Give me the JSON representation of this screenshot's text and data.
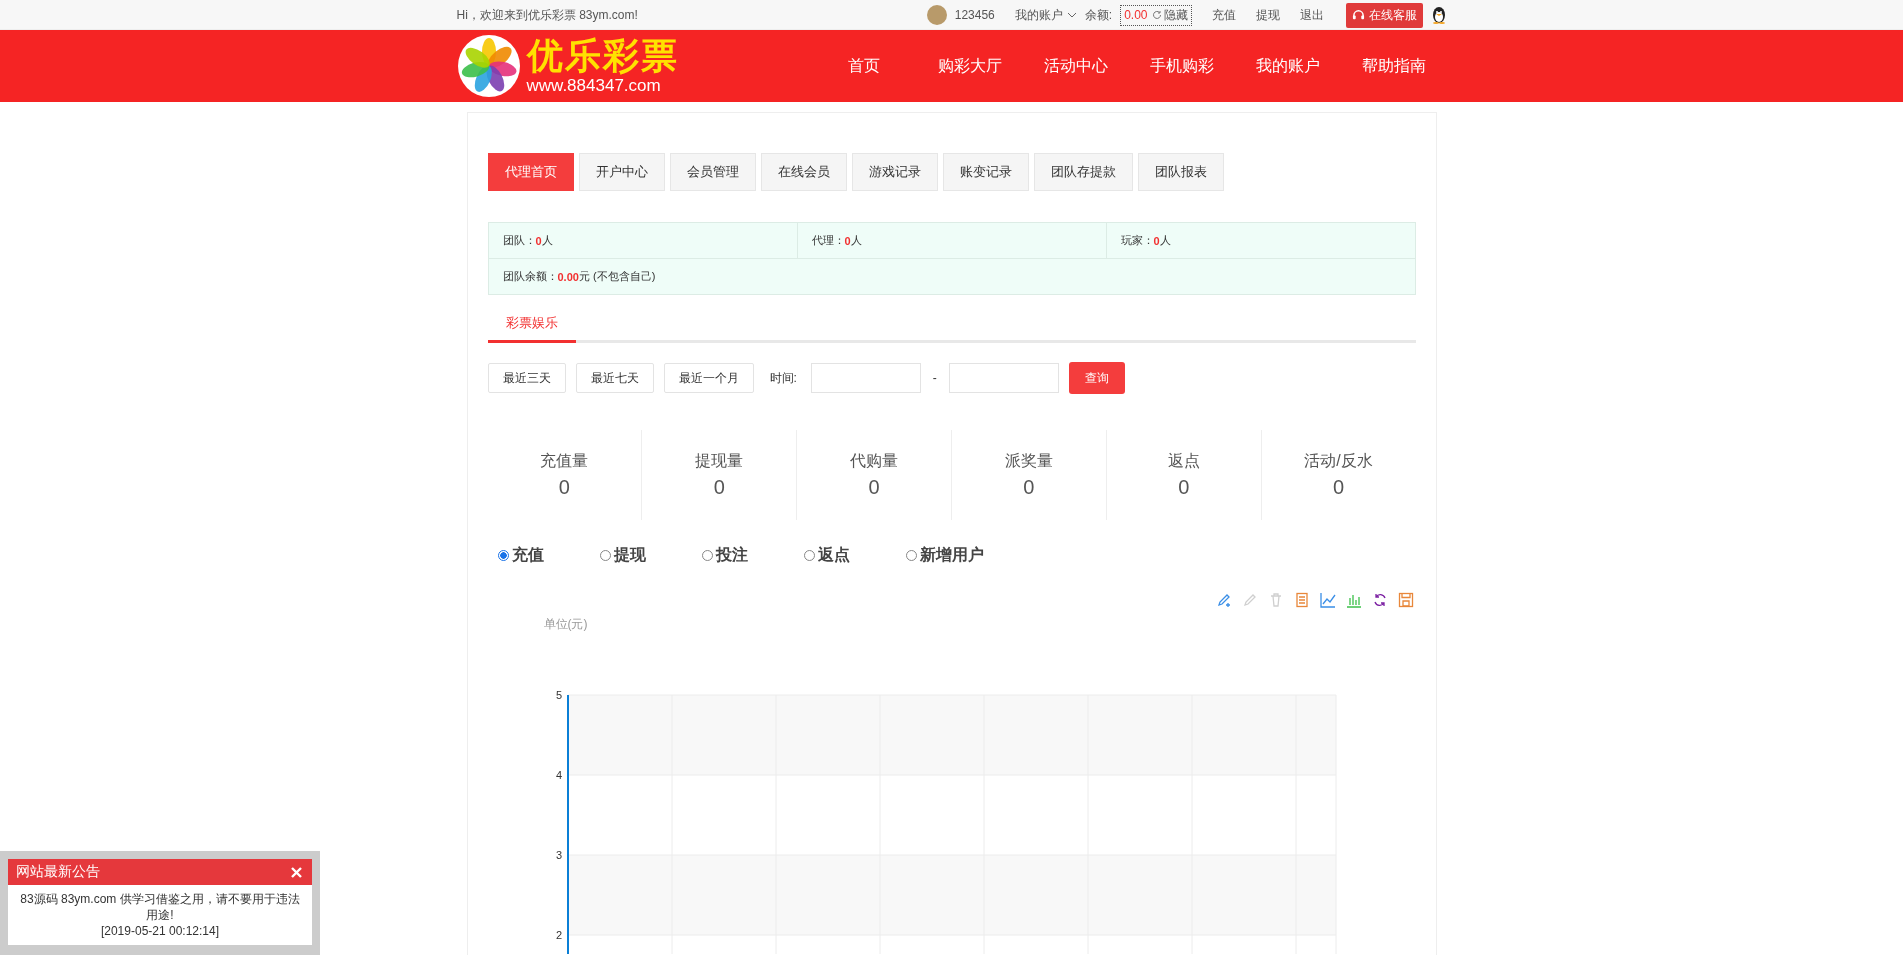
{
  "top_bar": {
    "greeting": "Hi，欢迎来到优乐彩票 83ym.com!",
    "username": "123456",
    "account_menu": "我的账户",
    "balance_label": "余额:",
    "balance": "0.00",
    "hide_toggle": "隐藏",
    "links": [
      "充值",
      "提现",
      "退出"
    ],
    "support_button": "在线客服"
  },
  "header": {
    "logo_title": "优乐彩票",
    "logo_url": "www.884347.com",
    "nav": [
      "首页",
      "购彩大厅",
      "活动中心",
      "手机购彩",
      "我的账户",
      "帮助指南"
    ]
  },
  "agent_tabs": [
    {
      "label": "代理首页",
      "selected": true
    },
    {
      "label": "开户中心",
      "selected": false
    },
    {
      "label": "会员管理",
      "selected": false
    },
    {
      "label": "在线会员",
      "selected": false
    },
    {
      "label": "游戏记录",
      "selected": false
    },
    {
      "label": "账变记录",
      "selected": false
    },
    {
      "label": "团队存提款",
      "selected": false
    },
    {
      "label": "团队报表",
      "selected": false
    }
  ],
  "summary": {
    "cells": [
      {
        "label": "团队：",
        "value": "0",
        "unit": "人"
      },
      {
        "label": "代理：",
        "value": "0",
        "unit": "人"
      },
      {
        "label": "玩家：",
        "value": "0",
        "unit": "人"
      }
    ],
    "balance": {
      "label": "团队余额：",
      "value": "0.00",
      "unit": "元",
      "note": "(不包含自己)"
    }
  },
  "sub_tabs": [
    {
      "label": "彩票娱乐",
      "selected": true
    }
  ],
  "filter": {
    "quick_ranges": [
      "最近三天",
      "最近七天",
      "最近一个月"
    ],
    "time_label": "时间:",
    "separator": "-",
    "query_button": "查询"
  },
  "stats": [
    {
      "label": "充值量",
      "value": "0"
    },
    {
      "label": "提现量",
      "value": "0"
    },
    {
      "label": "代购量",
      "value": "0"
    },
    {
      "label": "派奖量",
      "value": "0"
    },
    {
      "label": "返点",
      "value": "0"
    },
    {
      "label": "活动/反水",
      "value": "0"
    }
  ],
  "chart_options": [
    {
      "label": "充值",
      "selected": true
    },
    {
      "label": "提现",
      "selected": false
    },
    {
      "label": "投注",
      "selected": false
    },
    {
      "label": "返点",
      "selected": false
    },
    {
      "label": "新增用户",
      "selected": false
    }
  ],
  "chart": {
    "unit": "单位(元)",
    "y_axis_labels": [
      "5",
      "4",
      "3",
      "2"
    ]
  },
  "notice": {
    "title": "网站最新公告",
    "message": "83源码 83ym.com 供学习借鉴之用，请不要用于违法用途!",
    "time": "[2019-05-21 00:12:14]"
  }
}
